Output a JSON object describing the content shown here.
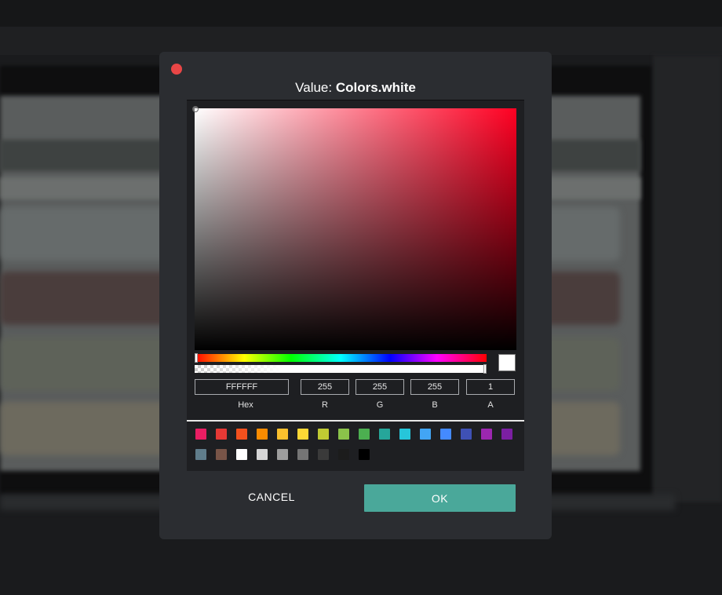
{
  "dialog": {
    "title_prefix": "Value: ",
    "title_value": "Colors.white",
    "buttons": {
      "cancel_label": "CANCEL",
      "ok_label": "OK",
      "ok_color": "#4aa89a"
    }
  },
  "picker": {
    "selected_color": "#FFFFFF",
    "hue_color": "#ff0022",
    "fields": {
      "hex": {
        "label": "Hex",
        "value": "FFFFFF"
      },
      "r": {
        "label": "R",
        "value": "255"
      },
      "g": {
        "label": "G",
        "value": "255"
      },
      "b": {
        "label": "B",
        "value": "255"
      },
      "a": {
        "label": "A",
        "value": "1"
      }
    },
    "palette_row1": [
      "#e91e63",
      "#e53935",
      "#f4511e",
      "#fb8c00",
      "#fbc02d",
      "#fdd835",
      "#c0ca33",
      "#8bc34a",
      "#4caf50",
      "#26a69a",
      "#26c6da",
      "#42a5f5",
      "#448aff",
      "#3f51b5",
      "#9c27b0",
      "#7b1fa2"
    ],
    "palette_row2": [
      "#607d8b",
      "#795548",
      "#ffffff",
      "#d6d6d6",
      "#9e9e9e",
      "#757575",
      "#3a3a3a",
      "#1c1c1c",
      "#000000"
    ]
  }
}
